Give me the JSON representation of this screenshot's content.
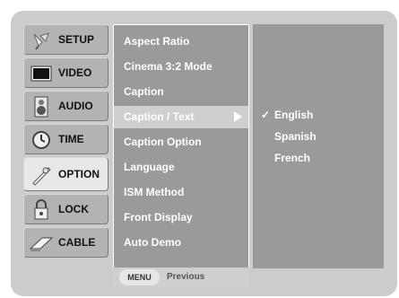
{
  "sidebar": {
    "items": [
      {
        "label": "SETUP",
        "icon": "satellite-icon",
        "selected": false
      },
      {
        "label": "VIDEO",
        "icon": "monitor-icon",
        "selected": false
      },
      {
        "label": "AUDIO",
        "icon": "speaker-icon",
        "selected": false
      },
      {
        "label": "TIME",
        "icon": "clock-icon",
        "selected": false
      },
      {
        "label": "OPTION",
        "icon": "option-icon",
        "selected": true
      },
      {
        "label": "LOCK",
        "icon": "lock-icon",
        "selected": false
      },
      {
        "label": "CABLE",
        "icon": "cable-icon",
        "selected": false
      }
    ]
  },
  "menu": {
    "items": [
      "Aspect Ratio",
      "Cinema 3:2 Mode",
      "Caption",
      "Caption / Text",
      "Caption Option",
      "Language",
      "ISM Method",
      "Front Display",
      "Auto Demo"
    ],
    "highlighted_index": 3
  },
  "submenu": {
    "check_mark": "✓",
    "items": [
      "English",
      "Spanish",
      "French"
    ],
    "selected_index": 0
  },
  "footer": {
    "menu_button": "MENU",
    "previous_label": "Previous"
  }
}
